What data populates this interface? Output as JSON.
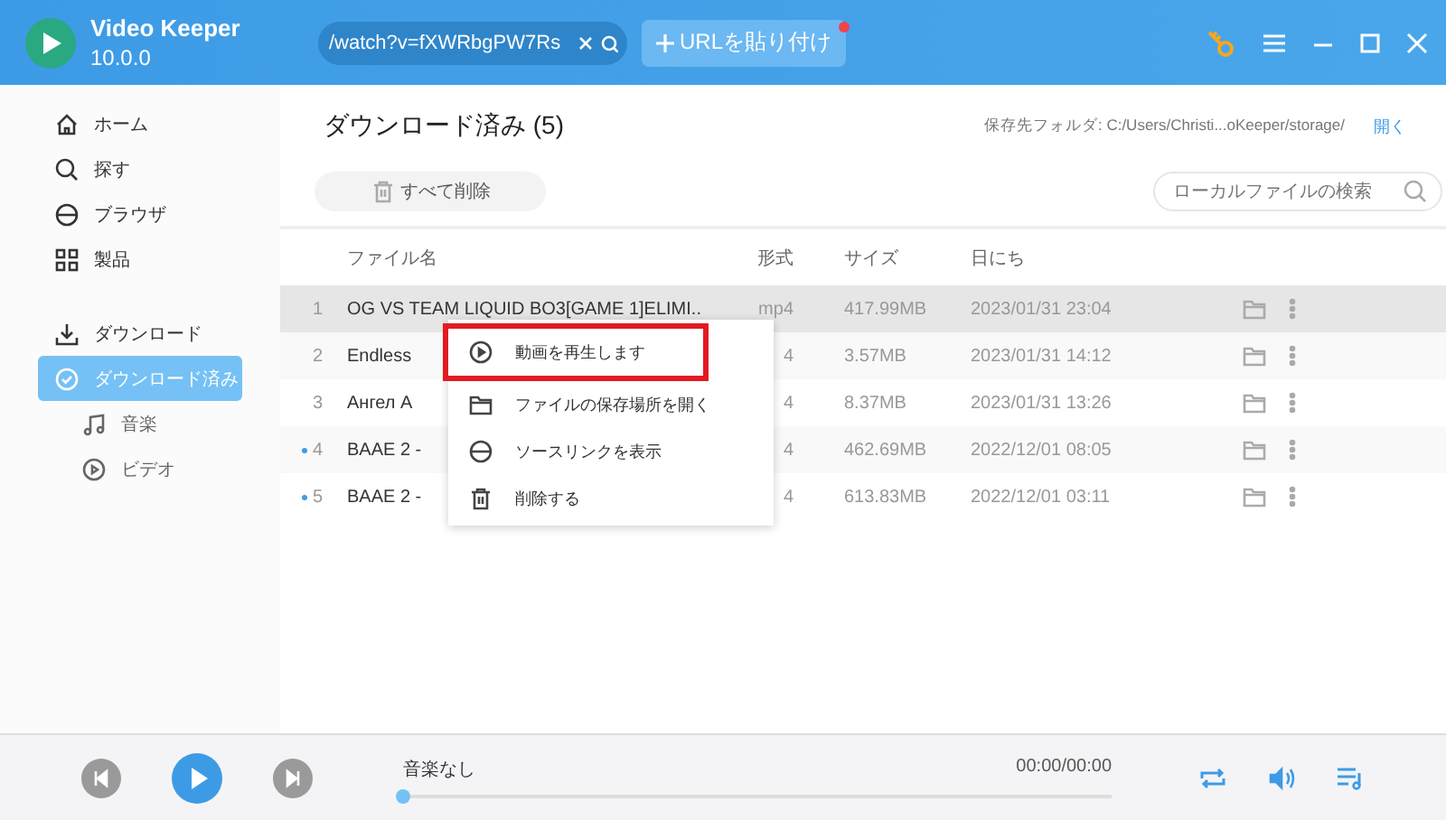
{
  "app": {
    "name": "Video Keeper",
    "version": "10.0.0"
  },
  "url_field": {
    "value": "/watch?v=fXWRbgPW7Rs"
  },
  "paste_button": {
    "label": "URLを貼り付け",
    "badge": true
  },
  "sidebar": {
    "items": [
      {
        "label": "ホーム",
        "kind": "home",
        "selected": false
      },
      {
        "label": "探す",
        "kind": "search",
        "selected": false
      },
      {
        "label": "ブラウザ",
        "kind": "browser",
        "selected": false
      },
      {
        "label": "製品",
        "kind": "grid",
        "selected": false
      },
      {
        "label": "ダウンロード",
        "kind": "download",
        "selected": false
      },
      {
        "label": "ダウンロード済み",
        "kind": "done",
        "selected": true,
        "children": [
          {
            "label": "音楽",
            "kind": "music",
            "selected": false
          },
          {
            "label": "ビデオ",
            "kind": "video",
            "selected": false
          }
        ]
      }
    ]
  },
  "page": {
    "title": "ダウンロード済み (5)",
    "folder_label": "保存先フォルダ: C:/Users/Christi...oKeeper/storage/",
    "open_link": "開く",
    "delete_all": "すべて削除",
    "search_placeholder": "ローカルファイルの検索"
  },
  "table": {
    "columns": [
      "ファイル名",
      "形式",
      "サイズ",
      "日にち"
    ],
    "rows": [
      {
        "index": "1",
        "name": "OG VS TEAM LIQUID BO3[GAME 1]ELIMI..",
        "format": "mp4",
        "size": "417.99MB",
        "date": "2023/01/31 23:04",
        "selected": true,
        "new": false
      },
      {
        "index": "2",
        "name": "Endless",
        "format": "4",
        "size": "3.57MB",
        "date": "2023/01/31 14:12",
        "selected": false,
        "new": false
      },
      {
        "index": "3",
        "name": "Ангел А",
        "format": "4",
        "size": "8.37MB",
        "date": "2023/01/31 13:26",
        "selected": false,
        "new": false
      },
      {
        "index": "4",
        "name": "BAAE 2 -",
        "format": "4",
        "size": "462.69MB",
        "date": "2022/12/01 08:05",
        "selected": false,
        "new": true
      },
      {
        "index": "5",
        "name": "BAAE 2 -",
        "format": "4",
        "size": "613.83MB",
        "date": "2022/12/01 03:11",
        "selected": false,
        "new": true
      }
    ]
  },
  "context_menu": {
    "items": [
      {
        "label": "動画を再生します",
        "kind": "play",
        "highlighted": true
      },
      {
        "label": "ファイルの保存場所を開く",
        "kind": "folder",
        "highlighted": false
      },
      {
        "label": "ソースリンクを表示",
        "kind": "link",
        "highlighted": false
      },
      {
        "label": "削除する",
        "kind": "delete",
        "highlighted": false
      }
    ]
  },
  "player": {
    "track": "音楽なし",
    "time": "00:00/00:00",
    "level": 0
  }
}
